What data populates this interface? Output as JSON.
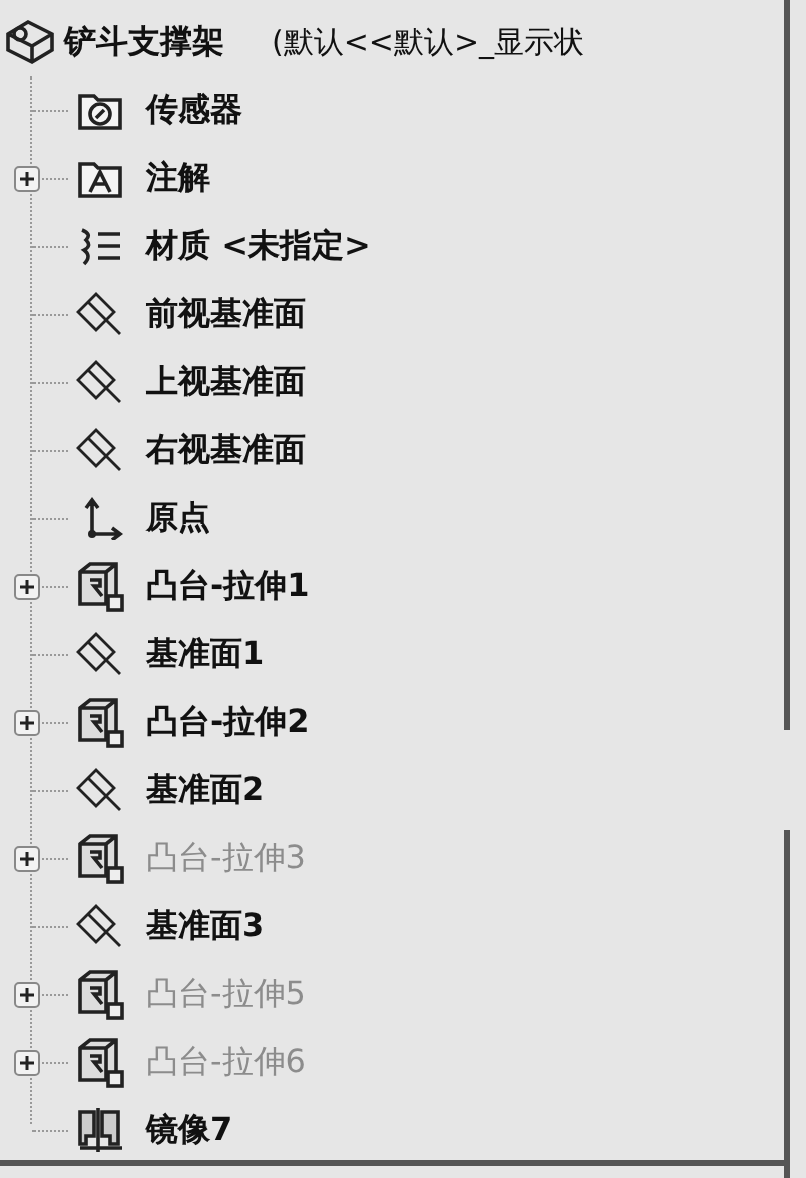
{
  "tree": {
    "root": {
      "kind": "part",
      "label": "铲斗支撑架",
      "config": "(默认<<默认>_显示状"
    },
    "children": [
      {
        "kind": "sensor",
        "label": "传感器",
        "expandable": false,
        "suppressed": false
      },
      {
        "kind": "annotation",
        "label": "注解",
        "expandable": true,
        "suppressed": false
      },
      {
        "kind": "material",
        "label": "材质 <未指定>",
        "expandable": false,
        "suppressed": false
      },
      {
        "kind": "plane",
        "label": "前视基准面",
        "expandable": false,
        "suppressed": false
      },
      {
        "kind": "plane",
        "label": "上视基准面",
        "expandable": false,
        "suppressed": false
      },
      {
        "kind": "plane",
        "label": "右视基准面",
        "expandable": false,
        "suppressed": false
      },
      {
        "kind": "origin",
        "label": "原点",
        "expandable": false,
        "suppressed": false
      },
      {
        "kind": "extrude",
        "label": "凸台-拉伸1",
        "expandable": true,
        "suppressed": false
      },
      {
        "kind": "plane",
        "label": "基准面1",
        "expandable": false,
        "suppressed": false
      },
      {
        "kind": "extrude",
        "label": "凸台-拉伸2",
        "expandable": true,
        "suppressed": false
      },
      {
        "kind": "plane",
        "label": "基准面2",
        "expandable": false,
        "suppressed": false
      },
      {
        "kind": "extrude",
        "label": "凸台-拉伸3",
        "expandable": true,
        "suppressed": true
      },
      {
        "kind": "plane",
        "label": "基准面3",
        "expandable": false,
        "suppressed": false
      },
      {
        "kind": "extrude",
        "label": "凸台-拉伸5",
        "expandable": true,
        "suppressed": true
      },
      {
        "kind": "extrude",
        "label": "凸台-拉伸6",
        "expandable": true,
        "suppressed": true
      },
      {
        "kind": "mirror",
        "label": "镜像7",
        "expandable": false,
        "suppressed": false
      }
    ]
  }
}
